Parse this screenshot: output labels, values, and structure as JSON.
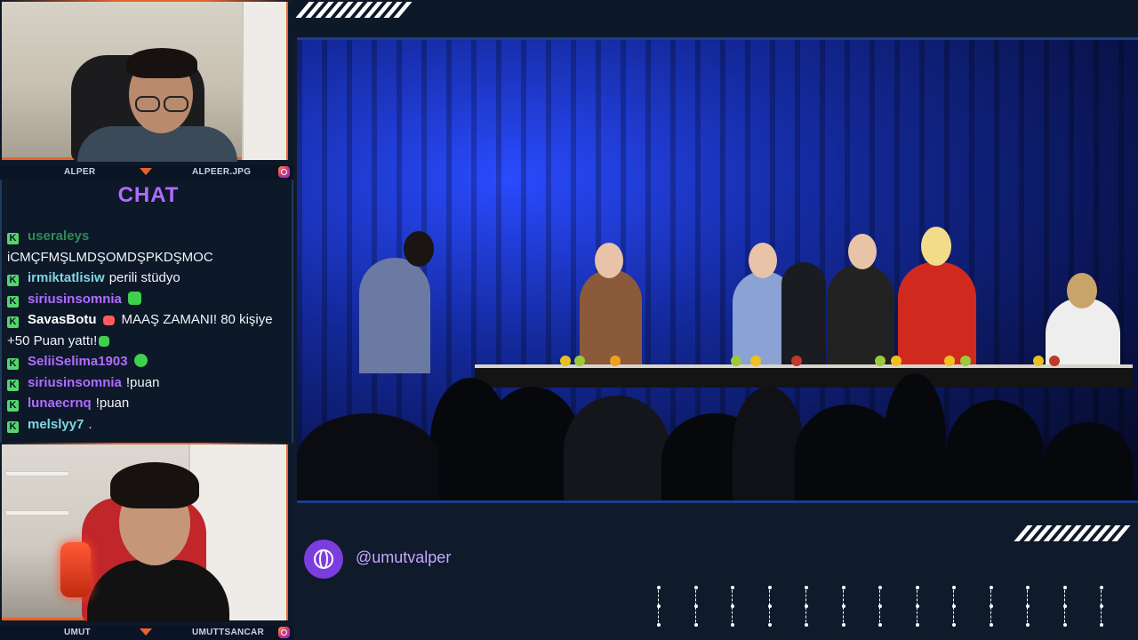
{
  "cams": {
    "top": {
      "left_name": "ALPER",
      "right_name": "ALPEER.JPG"
    },
    "bottom": {
      "left_name": "UMUT",
      "right_name": "UMUTTSANCAR"
    }
  },
  "chat": {
    "title": "CHAT",
    "messages": [
      {
        "user": "useraleys",
        "text": "",
        "color": "#2e8b57"
      },
      {
        "user": "",
        "text": "iCMÇFMŞLMDŞOMDŞPKDŞMOC",
        "color": "#9aa4b5"
      },
      {
        "user": "irmiktatlisiw",
        "text": "perili stüdyo",
        "color": "#7fd6e0"
      },
      {
        "user": "siriusinsomnia",
        "text": "",
        "color": "#b06cff"
      },
      {
        "user": "SavasBotu",
        "text": "MAAŞ ZAMANI! 80 kişiye +50 Puan yattı!",
        "color": "#ffffff"
      },
      {
        "user": "SeliiSelima1903",
        "text": "",
        "color": "#b06cff"
      },
      {
        "user": "siriusinsomnia",
        "text": "!puan",
        "color": "#b06cff"
      },
      {
        "user": "lunaecrnq",
        "text": "!puan",
        "color": "#b06cff"
      },
      {
        "user": "melslyy7",
        "text": ".",
        "color": "#7fd6e0"
      }
    ]
  },
  "footer": {
    "social_icon": "globe-icon",
    "handle": "@umutvalper"
  },
  "colors": {
    "accent_orange": "#e8632b",
    "accent_purple": "#b06cff",
    "background": "#0f1a2b"
  }
}
